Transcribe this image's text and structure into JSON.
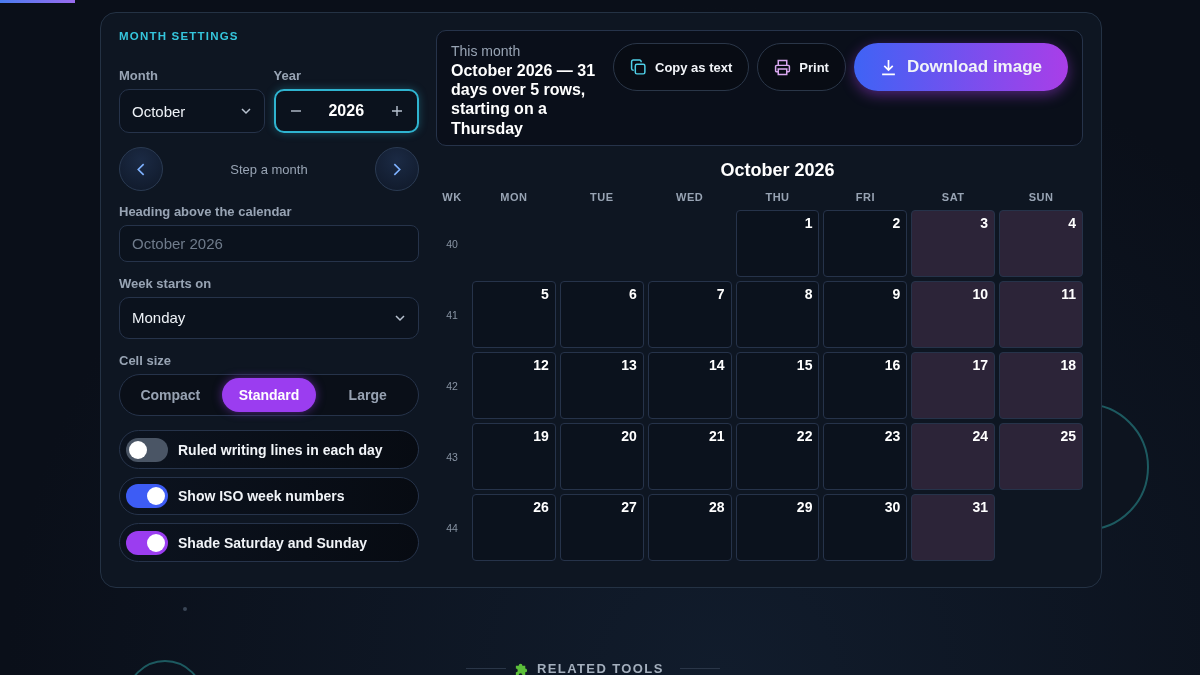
{
  "page_progress": {
    "level": 0.0625
  },
  "settings": {
    "heading": "MONTH SETTINGS",
    "month": {
      "label": "Month",
      "value": "October"
    },
    "year": {
      "label": "Year",
      "value": "2026"
    },
    "step": {
      "label": "Step a month"
    },
    "heading_field": {
      "label": "Heading above the calendar",
      "placeholder": "October 2026"
    },
    "week_start": {
      "label": "Week starts on",
      "value": "Monday"
    },
    "cell_size": {
      "label": "Cell size",
      "options": [
        {
          "label": "Compact",
          "selected": false
        },
        {
          "label": "Standard",
          "selected": true
        },
        {
          "label": "Large",
          "selected": false
        }
      ]
    },
    "toggles": [
      {
        "label": "Ruled writing lines in each day",
        "on": false
      },
      {
        "label": "Show ISO week numbers",
        "on": true,
        "color": "#3d5cf5"
      },
      {
        "label": "Shade Saturday and Sunday",
        "on": true,
        "color": "#9b3df0"
      }
    ]
  },
  "summary": {
    "caption": "This month",
    "text": "October 2026 — 31 days over 5 rows, starting on a Thursday"
  },
  "actions": [
    {
      "kind": "copy",
      "label": "Copy as text"
    },
    {
      "kind": "print",
      "label": "Print"
    },
    {
      "kind": "download",
      "label": "Download image"
    }
  ],
  "calendar": {
    "title": "October 2026",
    "week_header": "WK",
    "weekdays": [
      "MON",
      "TUE",
      "WED",
      "THU",
      "FRI",
      "SAT",
      "SUN"
    ],
    "weeks": [
      {
        "number": "40",
        "days": [
          {
            "kind": "blank"
          },
          {
            "kind": "blank"
          },
          {
            "kind": "blank"
          },
          {
            "kind": "day",
            "label": "1"
          },
          {
            "kind": "day",
            "label": "2"
          },
          {
            "kind": "day",
            "label": "3"
          },
          {
            "kind": "day",
            "label": "4"
          }
        ]
      },
      {
        "number": "41",
        "days": [
          {
            "kind": "day",
            "label": "5"
          },
          {
            "kind": "day",
            "label": "6"
          },
          {
            "kind": "day",
            "label": "7"
          },
          {
            "kind": "day",
            "label": "8"
          },
          {
            "kind": "day",
            "label": "9"
          },
          {
            "kind": "day",
            "label": "10"
          },
          {
            "kind": "day",
            "label": "11"
          }
        ]
      },
      {
        "number": "42",
        "days": [
          {
            "kind": "day",
            "label": "12"
          },
          {
            "kind": "day",
            "label": "13"
          },
          {
            "kind": "day",
            "label": "14"
          },
          {
            "kind": "day",
            "label": "15"
          },
          {
            "kind": "day",
            "label": "16"
          },
          {
            "kind": "day",
            "label": "17"
          },
          {
            "kind": "day",
            "label": "18"
          }
        ]
      },
      {
        "number": "43",
        "days": [
          {
            "kind": "day",
            "label": "19"
          },
          {
            "kind": "day",
            "label": "20"
          },
          {
            "kind": "day",
            "label": "21"
          },
          {
            "kind": "day",
            "label": "22"
          },
          {
            "kind": "day",
            "label": "23"
          },
          {
            "kind": "day",
            "label": "24"
          },
          {
            "kind": "day",
            "label": "25"
          }
        ]
      },
      {
        "number": "44",
        "days": [
          {
            "kind": "day",
            "label": "26"
          },
          {
            "kind": "day",
            "label": "27"
          },
          {
            "kind": "day",
            "label": "28"
          },
          {
            "kind": "day",
            "label": "29"
          },
          {
            "kind": "day",
            "label": "30"
          },
          {
            "kind": "day",
            "label": "31"
          },
          {
            "kind": "blank"
          }
        ]
      }
    ]
  },
  "related": {
    "label": "RELATED TOOLS"
  }
}
